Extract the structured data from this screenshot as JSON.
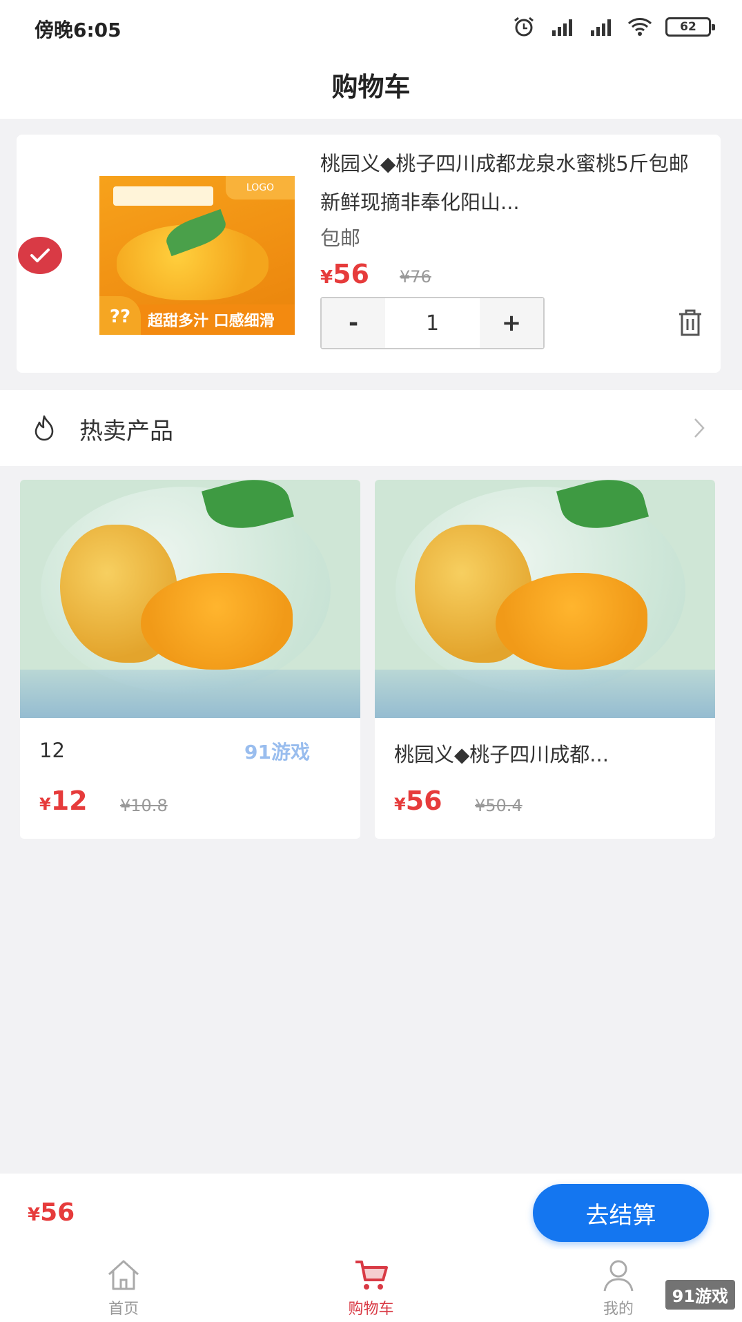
{
  "status_bar": {
    "time": "傍晚6:05",
    "battery": "62"
  },
  "header": {
    "title": "购物车"
  },
  "cart_item": {
    "title": "桃园义◆桃子四川成都龙泉水蜜桃5斤包邮新鲜现摘非奉化阳山...",
    "tag": "包邮",
    "currency": "¥",
    "price": "56",
    "old_price": "¥76",
    "quantity": "1",
    "minus_label": "-",
    "plus_label": "+",
    "thumb_logo": "LOGO",
    "thumb_badge": "??",
    "thumb_slogan": "超甜多汁 口感细滑",
    "selected": true
  },
  "hot_section": {
    "label": "热卖产品"
  },
  "products": [
    {
      "name": "12",
      "currency": "¥",
      "price": "12",
      "old_price": "¥10.8"
    },
    {
      "name": "桃园义◆桃子四川成都...",
      "currency": "¥",
      "price": "56",
      "old_price": "¥50.4"
    }
  ],
  "checkout": {
    "currency": "¥",
    "total": "56",
    "button_label": "去结算"
  },
  "tabbar": {
    "items": [
      {
        "label": "首页",
        "icon": "home-icon",
        "active": false
      },
      {
        "label": "购物车",
        "icon": "cart-icon",
        "active": true
      },
      {
        "label": "我的",
        "icon": "user-icon",
        "active": false
      }
    ]
  },
  "watermark": {
    "mid": "91游戏",
    "corner": "91游戏"
  },
  "colors": {
    "accent_red": "#e63b3b",
    "check_red": "#d93a45",
    "button_blue": "#1476f0"
  }
}
